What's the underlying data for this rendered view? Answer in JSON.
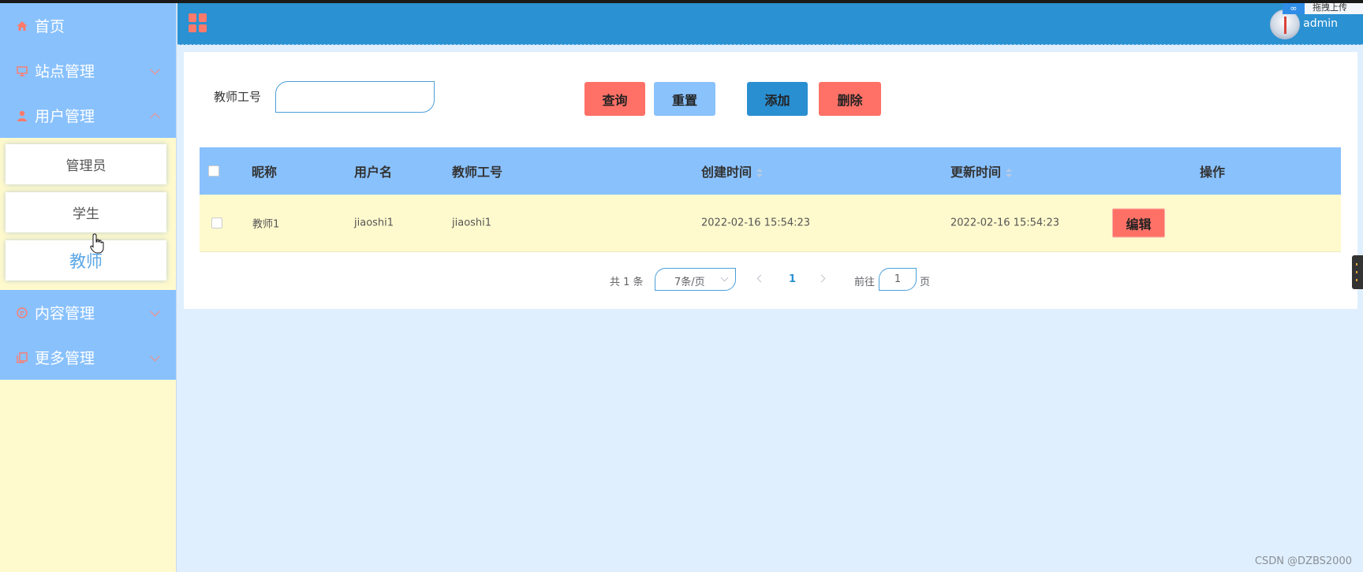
{
  "sidebar": {
    "menu": [
      {
        "label": "首页",
        "icon": "home-icon"
      },
      {
        "label": "站点管理",
        "icon": "monitor-icon"
      },
      {
        "label": "用户管理",
        "icon": "user-icon"
      },
      {
        "label": "内容管理",
        "icon": "chat-icon"
      },
      {
        "label": "更多管理",
        "icon": "copy-icon"
      }
    ],
    "submenu": [
      {
        "label": "管理员"
      },
      {
        "label": "学生"
      },
      {
        "label": "教师"
      }
    ],
    "active_submenu": "教师"
  },
  "header": {
    "username": "admin",
    "upload_badge": "拖拽上传"
  },
  "search": {
    "label": "教师工号",
    "value": ""
  },
  "buttons": {
    "query": "查询",
    "reset": "重置",
    "add": "添加",
    "delete": "删除"
  },
  "table": {
    "columns": [
      "昵称",
      "用户名",
      "教师工号",
      "创建时间",
      "更新时间",
      "操作"
    ],
    "rows": [
      {
        "nickname": "教师1",
        "username": "jiaoshi1",
        "teacher_id": "jiaoshi1",
        "created": "2022-02-16 15:54:23",
        "updated": "2022-02-16 15:54:23",
        "action": "编辑"
      }
    ]
  },
  "pagination": {
    "total": "共 1 条",
    "page_size": "7条/页",
    "current_page": "1",
    "goto_label": "前往",
    "goto_value": "1",
    "page_unit": "页"
  },
  "watermark": "CSDN @DZBS2000",
  "colors": {
    "sidebar_menu_bg": "#89c1fd",
    "header_bg": "#2a91d2",
    "accent_red": "#ff7166",
    "row_bg": "#fffacd",
    "page_bg": "#e0effd"
  }
}
